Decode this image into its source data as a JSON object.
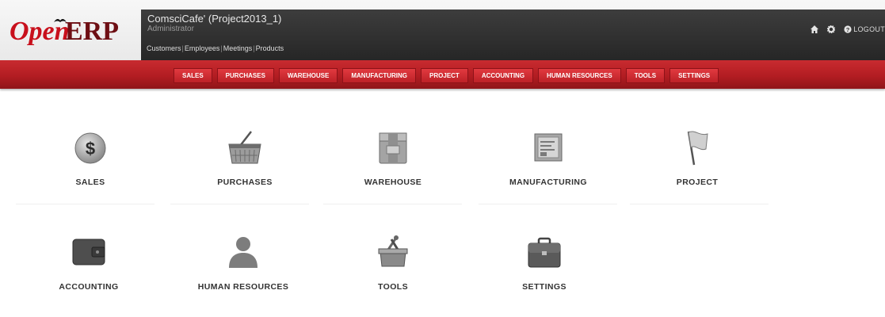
{
  "header": {
    "logo_text_open": "Open",
    "logo_text_erp": "ERP",
    "company": "ComsciCafe' (Project2013_1)",
    "user": "Administrator",
    "shortcuts": [
      "Customers",
      "Employees",
      "Meetings",
      "Products"
    ],
    "icons": [
      "home-icon",
      "gear-icon",
      "help-icon"
    ],
    "logout": "LOGOUT"
  },
  "menu": [
    "SALES",
    "PURCHASES",
    "WAREHOUSE",
    "MANUFACTURING",
    "PROJECT",
    "ACCOUNTING",
    "HUMAN RESOURCES",
    "TOOLS",
    "SETTINGS"
  ],
  "apps": [
    {
      "label": "SALES",
      "icon": "dollar-coin-icon"
    },
    {
      "label": "PURCHASES",
      "icon": "shopping-basket-icon"
    },
    {
      "label": "WAREHOUSE",
      "icon": "box-icon"
    },
    {
      "label": "MANUFACTURING",
      "icon": "machine-screen-icon"
    },
    {
      "label": "PROJECT",
      "icon": "flag-icon"
    },
    {
      "label": "ACCOUNTING",
      "icon": "wallet-icon"
    },
    {
      "label": "HUMAN RESOURCES",
      "icon": "person-icon"
    },
    {
      "label": "TOOLS",
      "icon": "toolbox-icon"
    },
    {
      "label": "SETTINGS",
      "icon": "briefcase-icon"
    }
  ],
  "colors": {
    "brand_red": "#c8101c",
    "menu_red": "#b31d22",
    "dark_bar": "#2e2e2e"
  }
}
